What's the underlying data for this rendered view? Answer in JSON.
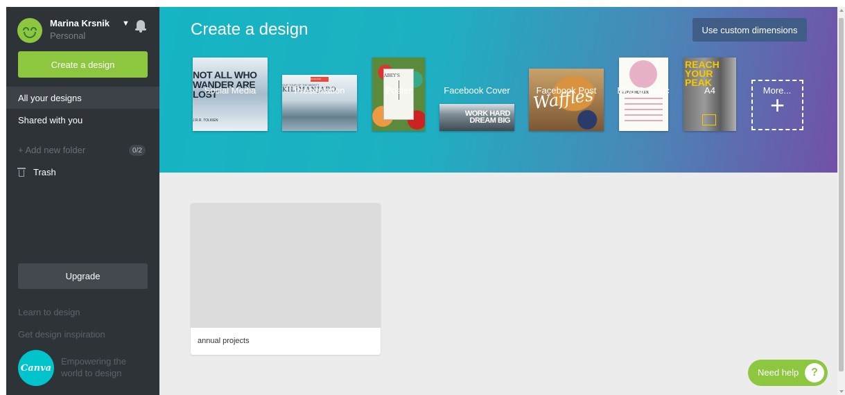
{
  "user": {
    "name": "Marina Krsnik",
    "plan": "Personal"
  },
  "sidebar": {
    "create_label": "Create a design",
    "nav": {
      "all": "All your designs",
      "shared": "Shared with you"
    },
    "add_folder": "+ Add new folder",
    "folder_count": "0/2",
    "trash": "Trash",
    "upgrade": "Upgrade",
    "learn": "Learn to design",
    "inspiration": "Get design inspiration",
    "logo_text": "Canva",
    "tagline": "Empowering the world to design"
  },
  "header": {
    "title": "Create a design",
    "custom_dimensions": "Use custom dimensions"
  },
  "templates": [
    {
      "label": "Social Media",
      "thumb_text": "NOT ALL WHO WANDER ARE LOST",
      "thumb_sub": "J.R.R. TOLKIEN"
    },
    {
      "label": "Presentation",
      "thumb_text": "KILIMANJARO",
      "thumb_sub": "OUR TOUR OF THE MIGHTY",
      "thumb_tag": "05.06.2018"
    },
    {
      "label": "Poster",
      "thumb_text": "ABEY'S"
    },
    {
      "label": "Facebook Cover",
      "thumb_text": "WORK HARD DREAM BIG"
    },
    {
      "label": "Facebook Post",
      "thumb_text": "Waffles"
    },
    {
      "label": "Blog Graphic",
      "thumb_text": "LAURYN HOLDEN"
    },
    {
      "label": "A4",
      "thumb_text": "REACH YOUR PEAK"
    },
    {
      "label": "More..."
    }
  ],
  "designs": [
    {
      "name": "annual projects"
    }
  ],
  "help": {
    "label": "Need help",
    "icon": "?"
  },
  "colors": {
    "accent_green": "#8dc63f",
    "sidebar": "#2e3338",
    "header_start": "#15b5c3",
    "header_end": "#7250a6"
  }
}
